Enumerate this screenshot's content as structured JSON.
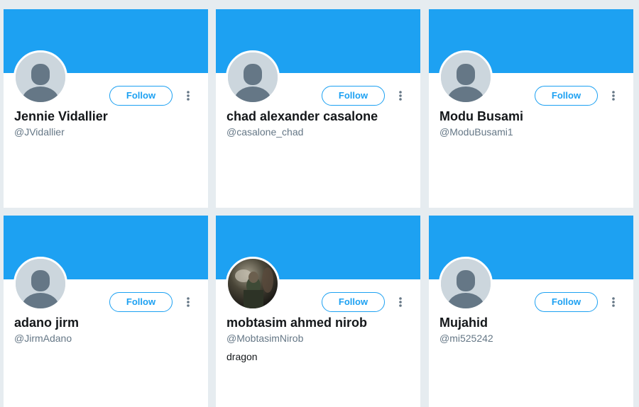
{
  "colors": {
    "page_background": "#e6ecf0",
    "banner": "#1da1f2",
    "accent": "#1da1f2",
    "name_text": "#14171a",
    "handle_text": "#657786",
    "default_avatar_bg": "#ccd6dd",
    "default_avatar_fg": "#657786"
  },
  "cards": [
    {
      "name": "Jennie Vidallier",
      "handle": "@JVidallier",
      "bio": "",
      "follow_label": "Follow",
      "avatar": "default-avatar-icon"
    },
    {
      "name": "chad alexander casalone",
      "handle": "@casalone_chad",
      "bio": "",
      "follow_label": "Follow",
      "avatar": "default-avatar-icon"
    },
    {
      "name": "Modu Busami",
      "handle": "@ModuBusami1",
      "bio": "",
      "follow_label": "Follow",
      "avatar": "default-avatar-icon"
    },
    {
      "name": "adano jirm",
      "handle": "@JirmAdano",
      "bio": "",
      "follow_label": "Follow",
      "avatar": "default-avatar-icon"
    },
    {
      "name": "mobtasim ahmed nirob",
      "handle": "@MobtasimNirob",
      "bio": "dragon",
      "follow_label": "Follow",
      "avatar": "profile-photo"
    },
    {
      "name": "Mujahid",
      "handle": "@mi525242",
      "bio": "",
      "follow_label": "Follow",
      "avatar": "default-avatar-icon"
    }
  ]
}
